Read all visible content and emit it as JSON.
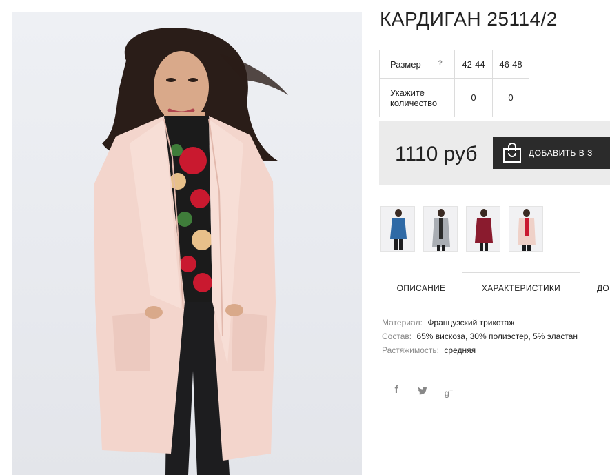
{
  "product": {
    "title": "КАРДИГАН 25114/2",
    "main_image_alt": "",
    "price": "1110 руб",
    "add_to_cart_label": "ДОБАВИТЬ В З"
  },
  "size_table": {
    "size_label": "Размер",
    "help_icon": "?",
    "sizes": [
      "42-44",
      "46-48"
    ],
    "quantity_label": "Укажите количество",
    "quantities": [
      "0",
      "0"
    ]
  },
  "thumbnails": [
    {
      "name": "blue",
      "coat_color": "#2f6aa6"
    },
    {
      "name": "grey",
      "coat_color": "#a9adb3"
    },
    {
      "name": "burgundy",
      "coat_color": "#8a1b2e"
    },
    {
      "name": "pink",
      "coat_color": "#efd1c8"
    }
  ],
  "tabs": [
    {
      "label": "ОПИСАНИЕ",
      "active": false
    },
    {
      "label": "ХАРАКТЕРИСТИКИ",
      "active": true
    },
    {
      "label": "ДО",
      "active": false
    }
  ],
  "characteristics": [
    {
      "key": "Материал:",
      "value": "Французский трикотаж"
    },
    {
      "key": "Состав:",
      "value": "65% вискоза, 30% полиэстер, 5% эластан"
    },
    {
      "key": "Растяжимость:",
      "value": "средняя"
    }
  ],
  "social": [
    {
      "icon": "facebook-icon",
      "glyph": "f"
    },
    {
      "icon": "twitter-icon",
      "glyph": "🐦"
    },
    {
      "icon": "google-plus-icon",
      "glyph": "g+"
    }
  ],
  "colors": {
    "price_box_bg": "#ebebeb",
    "cart_button_bg": "#2b2b2b",
    "coat_pink": "#f2d3ca"
  }
}
